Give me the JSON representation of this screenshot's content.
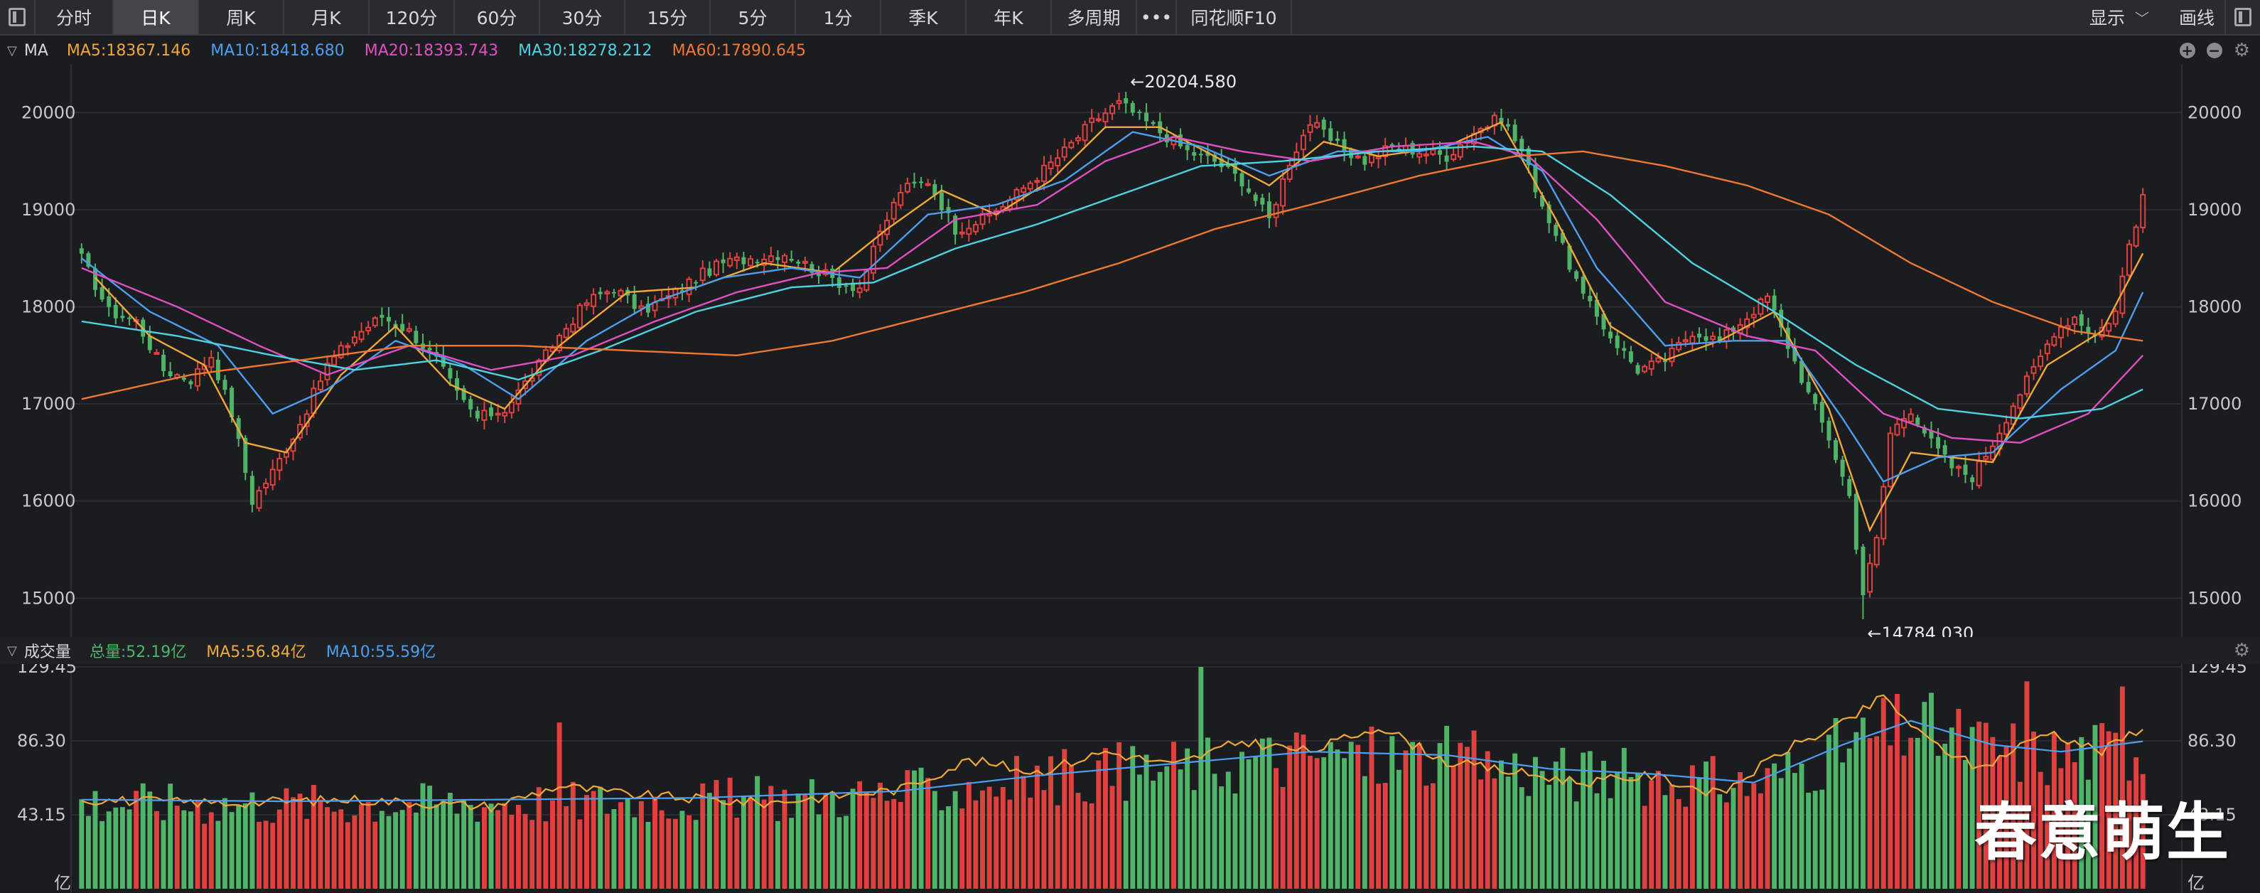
{
  "toolbar": {
    "buttons": [
      {
        "label": "分时",
        "width": 110
      },
      {
        "label": "日K",
        "width": 120,
        "active": true
      },
      {
        "label": "周K",
        "width": 120
      },
      {
        "label": "月K",
        "width": 120
      },
      {
        "label": "120分",
        "width": 120
      },
      {
        "label": "60分",
        "width": 120
      },
      {
        "label": "30分",
        "width": 120
      },
      {
        "label": "15分",
        "width": 120
      },
      {
        "label": "5分",
        "width": 120
      },
      {
        "label": "1分",
        "width": 120
      },
      {
        "label": "季K",
        "width": 120
      },
      {
        "label": "年K",
        "width": 120
      },
      {
        "label": "多周期",
        "width": 120
      },
      {
        "label": "•••",
        "width": 56
      },
      {
        "label": "同花顺F10",
        "width": 162
      }
    ],
    "display_label": "显示",
    "draw_label": "画线"
  },
  "ma_legend": {
    "name": "MA",
    "items": [
      {
        "label": "MA5:18367.146",
        "color": "#f0a838"
      },
      {
        "label": "MA10:18418.680",
        "color": "#4e9ef0"
      },
      {
        "label": "MA20:18393.743",
        "color": "#e050c0"
      },
      {
        "label": "MA30:18278.212",
        "color": "#4ed2e0"
      },
      {
        "label": "MA60:17890.645",
        "color": "#f07830"
      }
    ]
  },
  "vol_legend": {
    "name": "成交量",
    "items": [
      {
        "label": "总量:52.19亿",
        "color": "#4fb468"
      },
      {
        "label": "MA5:56.84亿",
        "color": "#f0a838"
      },
      {
        "label": "MA10:55.59亿",
        "color": "#4e9ef0"
      }
    ]
  },
  "watermark": "春意萌生",
  "chart_data": {
    "type": "candlestick",
    "price_axis": {
      "ticks": [
        "20000",
        "19000",
        "18000",
        "17000",
        "16000",
        "15000"
      ],
      "range": [
        14600,
        20500
      ]
    },
    "volume_axis": {
      "ticks": [
        "129.45",
        "86.30",
        "43.15"
      ],
      "unit": "亿",
      "range": [
        0,
        129.45
      ]
    },
    "annotations": {
      "high": "←20204.580",
      "low": "←14784.030"
    },
    "colors": {
      "up": "#e0413f",
      "down": "#4fb468",
      "grid": "#2c2d33"
    },
    "price_path": [
      [
        0,
        18500
      ],
      [
        4,
        17950
      ],
      [
        8,
        17850
      ],
      [
        12,
        17350
      ],
      [
        16,
        17250
      ],
      [
        19,
        17500
      ],
      [
        22,
        16900
      ],
      [
        25,
        16000
      ],
      [
        28,
        16300
      ],
      [
        32,
        16800
      ],
      [
        36,
        17400
      ],
      [
        40,
        17700
      ],
      [
        44,
        17900
      ],
      [
        48,
        17750
      ],
      [
        52,
        17450
      ],
      [
        55,
        17100
      ],
      [
        58,
        16850
      ],
      [
        62,
        16950
      ],
      [
        66,
        17300
      ],
      [
        70,
        17700
      ],
      [
        74,
        18050
      ],
      [
        78,
        18200
      ],
      [
        82,
        17950
      ],
      [
        86,
        18100
      ],
      [
        90,
        18300
      ],
      [
        94,
        18450
      ],
      [
        98,
        18500
      ],
      [
        103,
        18550
      ],
      [
        107,
        18400
      ],
      [
        111,
        18250
      ],
      [
        114,
        18200
      ],
      [
        117,
        18750
      ],
      [
        120,
        19200
      ],
      [
        124,
        19300
      ],
      [
        128,
        18800
      ],
      [
        132,
        18900
      ],
      [
        136,
        19100
      ],
      [
        140,
        19350
      ],
      [
        144,
        19600
      ],
      [
        148,
        19900
      ],
      [
        152,
        20100
      ],
      [
        155,
        19950
      ],
      [
        158,
        19800
      ],
      [
        162,
        19600
      ],
      [
        166,
        19500
      ],
      [
        170,
        19300
      ],
      [
        174,
        18900
      ],
      [
        177,
        19500
      ],
      [
        180,
        19900
      ],
      [
        184,
        19650
      ],
      [
        188,
        19500
      ],
      [
        192,
        19650
      ],
      [
        196,
        19600
      ],
      [
        200,
        19550
      ],
      [
        204,
        19800
      ],
      [
        208,
        19950
      ],
      [
        211,
        19600
      ],
      [
        214,
        19050
      ],
      [
        217,
        18600
      ],
      [
        220,
        18100
      ],
      [
        224,
        17700
      ],
      [
        228,
        17350
      ],
      [
        232,
        17450
      ],
      [
        236,
        17750
      ],
      [
        240,
        17650
      ],
      [
        244,
        17900
      ],
      [
        247,
        18100
      ],
      [
        250,
        17600
      ],
      [
        253,
        17100
      ],
      [
        256,
        16650
      ],
      [
        259,
        16050
      ],
      [
        261,
        15050
      ],
      [
        263,
        15600
      ],
      [
        265,
        16700
      ],
      [
        268,
        16950
      ],
      [
        271,
        16600
      ],
      [
        274,
        16350
      ],
      [
        277,
        16250
      ],
      [
        280,
        16600
      ],
      [
        283,
        17000
      ],
      [
        286,
        17350
      ],
      [
        289,
        17750
      ],
      [
        292,
        17900
      ],
      [
        295,
        17700
      ],
      [
        298,
        17950
      ],
      [
        300,
        18650
      ],
      [
        302,
        19100
      ]
    ],
    "ma_path": {
      "MA5": [
        [
          2,
          18300
        ],
        [
          10,
          17700
        ],
        [
          18,
          17400
        ],
        [
          24,
          16600
        ],
        [
          30,
          16500
        ],
        [
          38,
          17300
        ],
        [
          46,
          17800
        ],
        [
          54,
          17200
        ],
        [
          62,
          16950
        ],
        [
          70,
          17600
        ],
        [
          80,
          18150
        ],
        [
          90,
          18200
        ],
        [
          100,
          18450
        ],
        [
          110,
          18350
        ],
        [
          118,
          18800
        ],
        [
          126,
          19200
        ],
        [
          134,
          18950
        ],
        [
          142,
          19300
        ],
        [
          150,
          19850
        ],
        [
          158,
          19850
        ],
        [
          166,
          19550
        ],
        [
          174,
          19250
        ],
        [
          182,
          19700
        ],
        [
          190,
          19550
        ],
        [
          200,
          19650
        ],
        [
          208,
          19900
        ],
        [
          216,
          18900
        ],
        [
          224,
          17800
        ],
        [
          232,
          17450
        ],
        [
          240,
          17650
        ],
        [
          248,
          17950
        ],
        [
          256,
          16950
        ],
        [
          262,
          15700
        ],
        [
          268,
          16500
        ],
        [
          274,
          16450
        ],
        [
          280,
          16400
        ],
        [
          288,
          17400
        ],
        [
          296,
          17750
        ],
        [
          302,
          18550
        ]
      ],
      "MA10": [
        [
          0,
          18500
        ],
        [
          10,
          17950
        ],
        [
          20,
          17600
        ],
        [
          28,
          16900
        ],
        [
          36,
          17150
        ],
        [
          46,
          17650
        ],
        [
          56,
          17400
        ],
        [
          64,
          17050
        ],
        [
          74,
          17650
        ],
        [
          84,
          18050
        ],
        [
          94,
          18300
        ],
        [
          104,
          18400
        ],
        [
          114,
          18300
        ],
        [
          124,
          18950
        ],
        [
          134,
          19050
        ],
        [
          144,
          19300
        ],
        [
          154,
          19800
        ],
        [
          164,
          19650
        ],
        [
          174,
          19350
        ],
        [
          184,
          19600
        ],
        [
          196,
          19600
        ],
        [
          206,
          19750
        ],
        [
          214,
          19400
        ],
        [
          222,
          18400
        ],
        [
          232,
          17600
        ],
        [
          242,
          17650
        ],
        [
          250,
          17650
        ],
        [
          258,
          16850
        ],
        [
          264,
          16200
        ],
        [
          272,
          16450
        ],
        [
          280,
          16500
        ],
        [
          290,
          17150
        ],
        [
          298,
          17550
        ],
        [
          302,
          18150
        ]
      ],
      "MA20": [
        [
          0,
          18400
        ],
        [
          14,
          18000
        ],
        [
          26,
          17600
        ],
        [
          36,
          17300
        ],
        [
          48,
          17600
        ],
        [
          60,
          17350
        ],
        [
          72,
          17500
        ],
        [
          84,
          17850
        ],
        [
          96,
          18150
        ],
        [
          108,
          18350
        ],
        [
          118,
          18400
        ],
        [
          128,
          18900
        ],
        [
          140,
          19050
        ],
        [
          150,
          19500
        ],
        [
          160,
          19750
        ],
        [
          170,
          19600
        ],
        [
          180,
          19500
        ],
        [
          192,
          19650
        ],
        [
          204,
          19700
        ],
        [
          212,
          19550
        ],
        [
          222,
          18900
        ],
        [
          232,
          18050
        ],
        [
          244,
          17700
        ],
        [
          254,
          17550
        ],
        [
          264,
          16900
        ],
        [
          274,
          16650
        ],
        [
          284,
          16600
        ],
        [
          294,
          16900
        ],
        [
          302,
          17500
        ]
      ],
      "MA30": [
        [
          0,
          17850
        ],
        [
          14,
          17700
        ],
        [
          28,
          17500
        ],
        [
          40,
          17350
        ],
        [
          52,
          17450
        ],
        [
          64,
          17250
        ],
        [
          76,
          17550
        ],
        [
          90,
          17950
        ],
        [
          104,
          18200
        ],
        [
          116,
          18250
        ],
        [
          128,
          18600
        ],
        [
          140,
          18850
        ],
        [
          152,
          19150
        ],
        [
          164,
          19450
        ],
        [
          176,
          19500
        ],
        [
          190,
          19600
        ],
        [
          204,
          19650
        ],
        [
          214,
          19600
        ],
        [
          224,
          19150
        ],
        [
          236,
          18450
        ],
        [
          248,
          17950
        ],
        [
          260,
          17400
        ],
        [
          272,
          16950
        ],
        [
          284,
          16850
        ],
        [
          296,
          16950
        ],
        [
          302,
          17150
        ]
      ],
      "MA60": [
        [
          0,
          17050
        ],
        [
          16,
          17300
        ],
        [
          32,
          17450
        ],
        [
          48,
          17600
        ],
        [
          64,
          17600
        ],
        [
          80,
          17550
        ],
        [
          96,
          17500
        ],
        [
          110,
          17650
        ],
        [
          124,
          17900
        ],
        [
          138,
          18150
        ],
        [
          152,
          18450
        ],
        [
          166,
          18800
        ],
        [
          180,
          19050
        ],
        [
          196,
          19350
        ],
        [
          210,
          19550
        ],
        [
          220,
          19600
        ],
        [
          232,
          19450
        ],
        [
          244,
          19250
        ],
        [
          256,
          18950
        ],
        [
          268,
          18450
        ],
        [
          280,
          18050
        ],
        [
          292,
          17750
        ],
        [
          302,
          17650
        ]
      ]
    },
    "volume_ma": {
      "MA5": [
        [
          0,
          52
        ],
        [
          20,
          50
        ],
        [
          40,
          52
        ],
        [
          60,
          48
        ],
        [
          70,
          60
        ],
        [
          80,
          55
        ],
        [
          100,
          50
        ],
        [
          120,
          58
        ],
        [
          130,
          75
        ],
        [
          140,
          68
        ],
        [
          150,
          80
        ],
        [
          160,
          72
        ],
        [
          170,
          86
        ],
        [
          180,
          80
        ],
        [
          190,
          95
        ],
        [
          200,
          74
        ],
        [
          210,
          68
        ],
        [
          220,
          62
        ],
        [
          230,
          66
        ],
        [
          240,
          55
        ],
        [
          250,
          82
        ],
        [
          258,
          96
        ],
        [
          264,
          112
        ],
        [
          270,
          88
        ],
        [
          278,
          70
        ],
        [
          288,
          92
        ],
        [
          296,
          80
        ],
        [
          302,
          95
        ]
      ],
      "MA10": [
        [
          0,
          52
        ],
        [
          30,
          51
        ],
        [
          60,
          52
        ],
        [
          90,
          53
        ],
        [
          120,
          57
        ],
        [
          140,
          66
        ],
        [
          160,
          73
        ],
        [
          180,
          80
        ],
        [
          200,
          78
        ],
        [
          215,
          70
        ],
        [
          230,
          67
        ],
        [
          245,
          62
        ],
        [
          258,
          84
        ],
        [
          268,
          98
        ],
        [
          280,
          84
        ],
        [
          290,
          80
        ],
        [
          302,
          86
        ]
      ]
    }
  }
}
